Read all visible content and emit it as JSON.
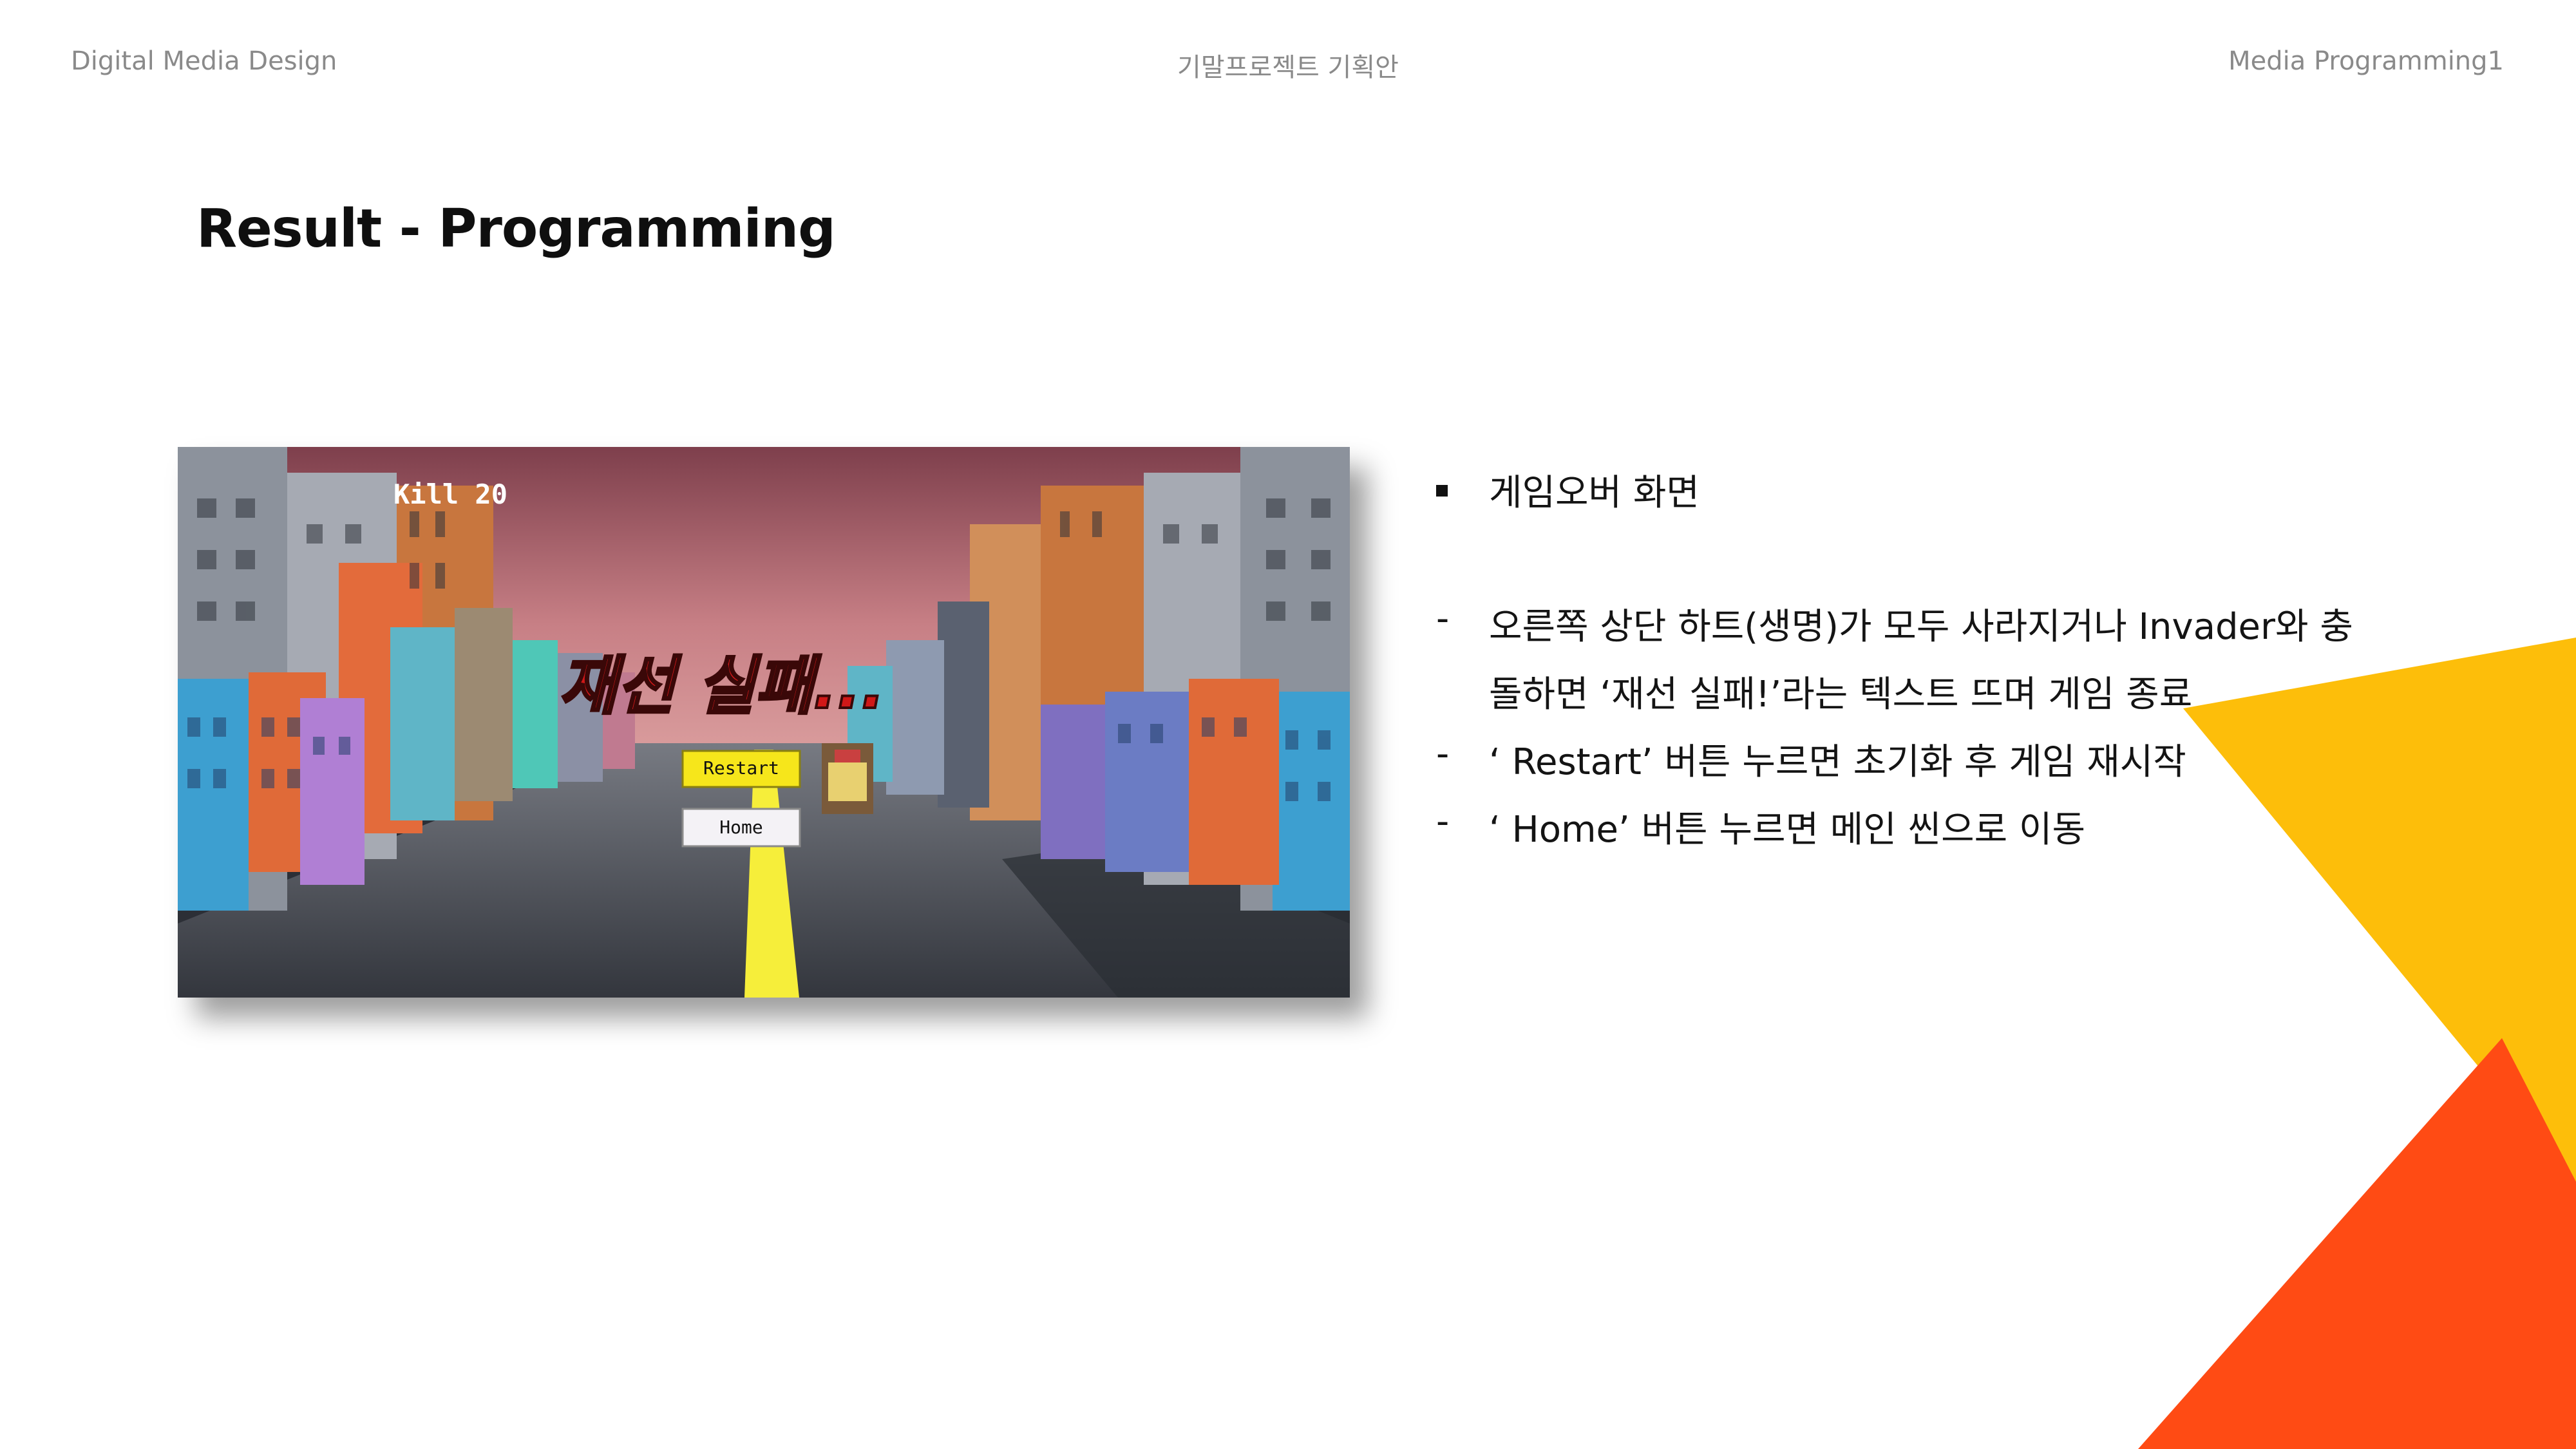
{
  "header": {
    "left": "Digital Media Design",
    "center": "기말프로젝트 기획안",
    "right": "Media Programming1"
  },
  "slide": {
    "title": "Result - Programming"
  },
  "screenshot": {
    "kill_label": "Kill 20",
    "fail_text": "재선 실패...",
    "restart_label": "Restart",
    "home_label": "Home"
  },
  "bullets": [
    {
      "marker": "square",
      "text": "게임오버 화면"
    },
    {
      "marker": "-",
      "text": "오른쪽 상단 하트(생명)가 모두 사라지거나 Invader와 충"
    },
    {
      "marker": "",
      "text": "돌하면 ‘재선 실패!’라는 텍스트 뜨며 게임 종료"
    },
    {
      "marker": "-",
      "text": "‘ Restart’ 버튼 누르면 초기화 후 게임 재시작"
    },
    {
      "marker": "-",
      "text": "‘ Home’ 버튼 누르면 메인 씬으로 이동"
    }
  ],
  "colors": {
    "accent_yellow": "#FDBE0A",
    "accent_orange": "#FF4B14",
    "road": "#3d4048",
    "sky_top": "#8f4a55",
    "fail_red": "#d01818",
    "button_yellow": "#f6e61b"
  },
  "icons": {
    "bullet_square": "square-bullet-icon"
  }
}
